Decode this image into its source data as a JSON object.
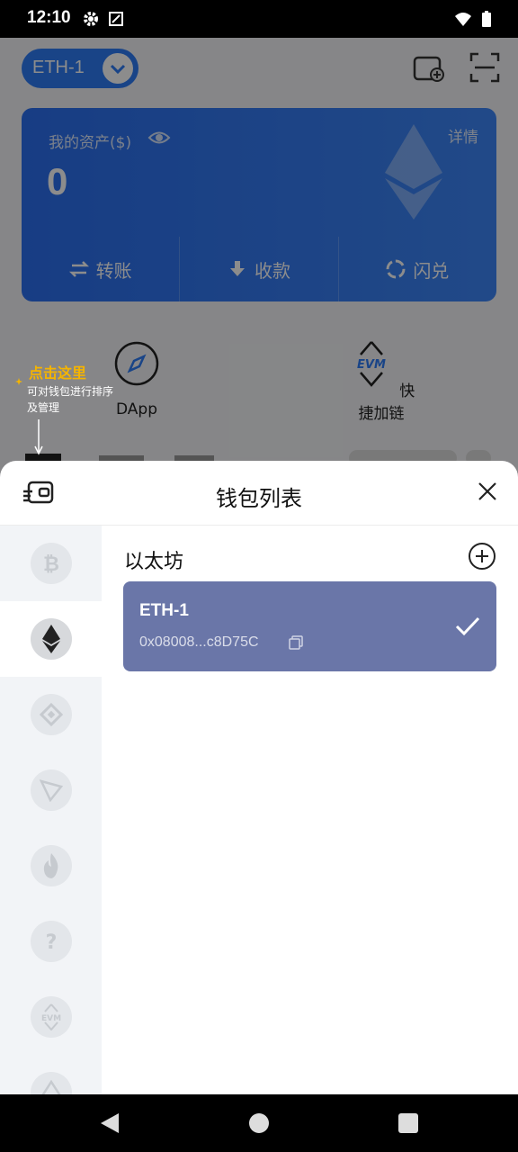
{
  "status_bar": {
    "time": "12:10",
    "icons": [
      "gear-icon",
      "screenshot-icon",
      "wifi-icon",
      "battery-icon"
    ]
  },
  "background_app": {
    "chain_selector": "ETH-1",
    "asset_card": {
      "label": "我的资产($)",
      "value": "0",
      "detail_link": "详情",
      "actions": [
        {
          "label": "转账",
          "icon": "transfer-icon"
        },
        {
          "label": "收款",
          "icon": "receive-icon"
        },
        {
          "label": "闪兑",
          "icon": "swap-icon"
        }
      ]
    },
    "tip": {
      "title": "点击这里",
      "text": "可对钱包进行排序及管理"
    },
    "quick_items": [
      {
        "label": "DApp",
        "icon": "compass-icon"
      },
      {
        "label": "快捷加链",
        "icon": "evm-icon"
      }
    ]
  },
  "sheet": {
    "title": "钱包列表",
    "sidebar_chains": [
      {
        "icon": "bitcoin-icon",
        "active": false
      },
      {
        "icon": "ethereum-icon",
        "active": true
      },
      {
        "icon": "bnb-icon",
        "active": false
      },
      {
        "icon": "tron-icon",
        "active": false
      },
      {
        "icon": "heco-icon",
        "active": false
      },
      {
        "icon": "unknown-chain-icon",
        "active": false
      },
      {
        "icon": "evm-icon",
        "active": false
      },
      {
        "icon": "chain-icon",
        "active": false
      }
    ],
    "group_title": "以太坊",
    "wallets": [
      {
        "name": "ETH-1",
        "address": "0x08008...c8D75C",
        "selected": true
      }
    ]
  },
  "colors": {
    "primary_blue": "#2f7cf6",
    "wallet_card": "#6a76a8",
    "tip_yellow": "#f5b400"
  }
}
